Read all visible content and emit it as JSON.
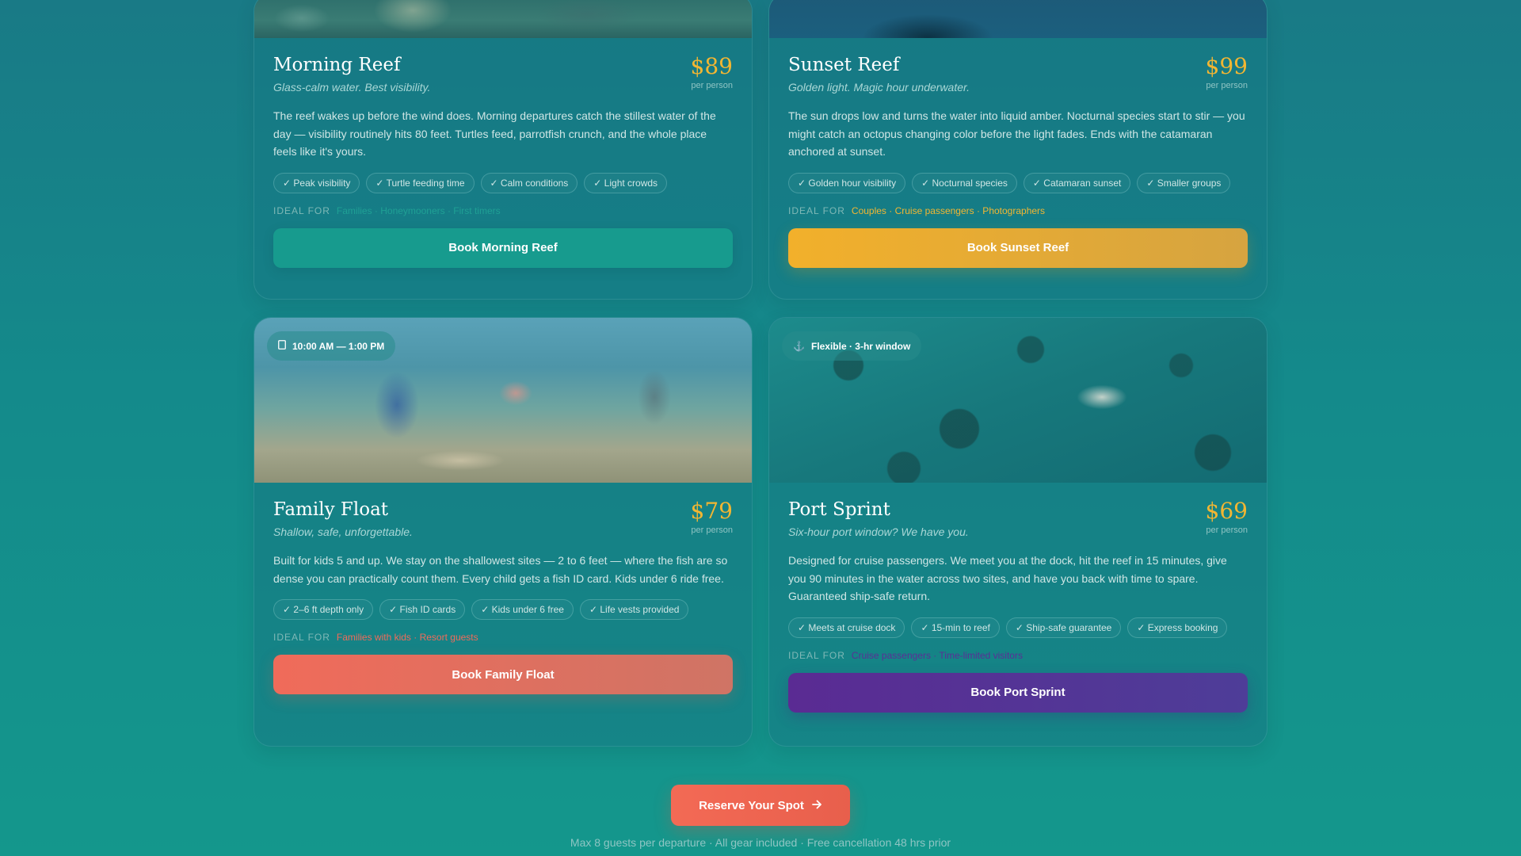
{
  "tours": [
    {
      "title": "Morning Reef",
      "tagline": "Glass-calm water. Best visibility.",
      "price": "$89",
      "per": "per person",
      "description": "The reef wakes up before the wind does. Morning departures catch the stillest water of the day — visibility routinely hits 80 feet. Turtles feed, parrotfish crunch, and the whole place feels like it's yours.",
      "tags": [
        "✓ Peak visibility",
        "✓ Turtle feeding time",
        "✓ Calm conditions",
        "✓ Light crowds"
      ],
      "ideal_label": "IDEAL FOR",
      "ideal": "Families · Honeymooners · First timers",
      "ideal_color": "#1fa095",
      "button": "Book Morning Reef"
    },
    {
      "title": "Sunset Reef",
      "tagline": "Golden light. Magic hour underwater.",
      "price": "$99",
      "per": "per person",
      "description": "The sun drops low and turns the water into liquid amber. Nocturnal species start to stir — you might catch an octopus changing color before the light fades. Ends with the catamaran anchored at sunset.",
      "tags": [
        "✓ Golden hour visibility",
        "✓ Nocturnal species",
        "✓ Catamaran sunset",
        "✓ Smaller groups"
      ],
      "ideal_label": "IDEAL FOR",
      "ideal": "Couples · Cruise passengers · Photographers",
      "ideal_color": "#f2b632",
      "button": "Book Sunset Reef"
    },
    {
      "title": "Family Float",
      "tagline": "Shallow, safe, unforgettable.",
      "price": "$79",
      "per": "per person",
      "badge": "10:00 AM — 1:00 PM",
      "badge_icon": "clock-icon",
      "description": "Built for kids 5 and up. We stay on the shallowest sites — 2 to 6 feet — where the fish are so dense you can practically count them. Every child gets a fish ID card. Kids under 6 ride free.",
      "tags": [
        "✓ 2–6 ft depth only",
        "✓ Fish ID cards",
        "✓ Kids under 6 free",
        "✓ Life vests provided"
      ],
      "ideal_label": "IDEAL FOR",
      "ideal": "Families with kids · Resort guests",
      "ideal_color": "#f06b5a",
      "button": "Book Family Float"
    },
    {
      "title": "Port Sprint",
      "tagline": "Six-hour port window? We have you.",
      "price": "$69",
      "per": "per person",
      "badge": "Flexible · 3-hr window",
      "badge_icon": "anchor-icon",
      "description": "Designed for cruise passengers. We meet you at the dock, hit the reef in 15 minutes, give you 90 minutes in the water across two sites, and have you back with time to spare. Guaranteed ship-safe return.",
      "tags": [
        "✓ Meets at cruise dock",
        "✓ 15-min to reef",
        "✓ Ship-safe guarantee",
        "✓ Express booking"
      ],
      "ideal_label": "IDEAL FOR",
      "ideal": "Cruise passengers · Time-limited visitors",
      "ideal_color": "#5b2f95",
      "button": "Book Port Sprint"
    }
  ],
  "cta": {
    "label": "Reserve Your Spot",
    "icon": "arrow-right-icon"
  },
  "footer": "Max 8 guests per departure · All gear included · Free cancellation 48 hrs prior"
}
